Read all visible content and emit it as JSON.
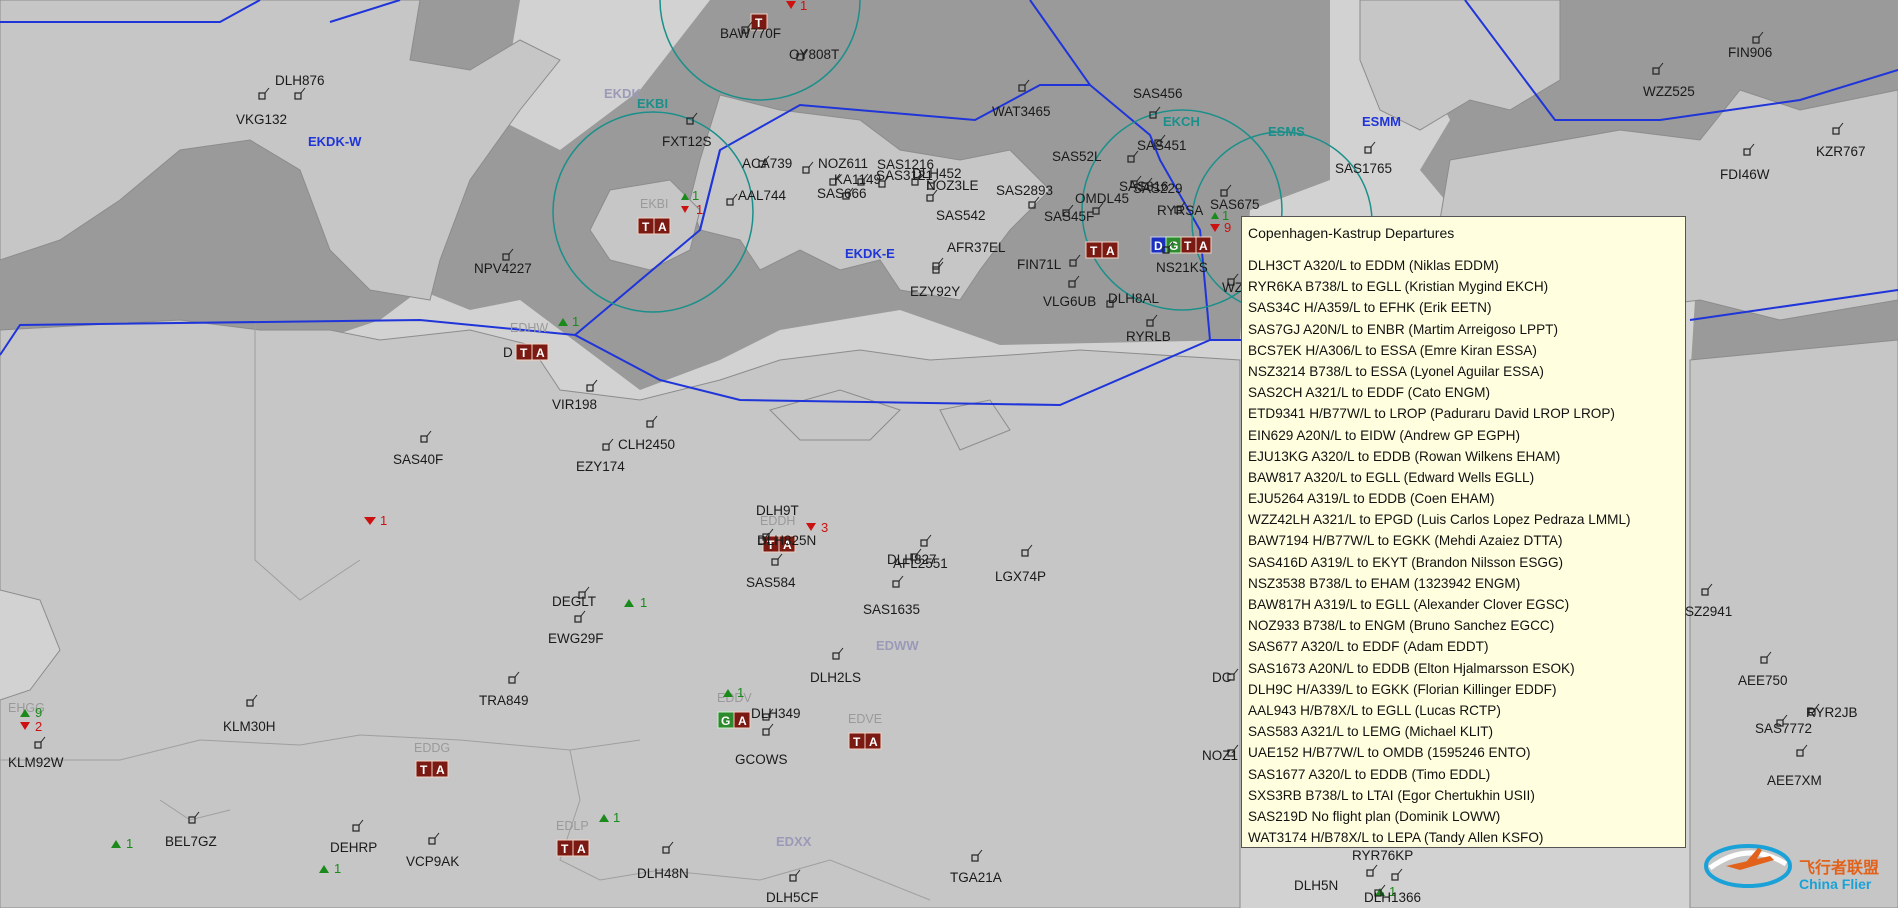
{
  "colors": {
    "background": "#d2d2d2",
    "land": "#c6c6c6",
    "water": "#9a9a9a",
    "fir_boundary": "#1f35d9",
    "ctr_ring": "#1b8f8a",
    "arrival_marker": "#1a8a1a",
    "departure_marker": "#cc1111",
    "atc_tower": "#7a1a12",
    "atc_delivery": "#1a2fbf",
    "atc_ground": "#2d8a2d",
    "panel_bg": "#fffedf"
  },
  "sectors": [
    {
      "id": "ekdk-w",
      "label": "EKDK-W"
    },
    {
      "id": "ekdk-e",
      "label": "EKDK-E"
    },
    {
      "id": "esmm",
      "label": "ESMM"
    },
    {
      "id": "edww",
      "label": "EDWW"
    },
    {
      "id": "edxx",
      "label": "EDXX"
    },
    {
      "id": "ekdk",
      "label": "EKDK"
    }
  ],
  "airports": [
    {
      "icao": "EKBI",
      "ring_label": "EKBI",
      "arrivals": "1",
      "departures": "1",
      "atc": [
        "T",
        "A"
      ]
    },
    {
      "icao": "EKCH",
      "ring_label": "EKCH",
      "arrivals": "1",
      "departures": "9",
      "atc": [
        "T",
        "A",
        "D",
        "G",
        "T",
        "A"
      ]
    },
    {
      "icao": "ESMS",
      "ring_label": "ESMS"
    },
    {
      "icao": "EKRN",
      "departures": "1",
      "atc": [
        "T"
      ]
    },
    {
      "icao": "EDHW",
      "label": "EDHW",
      "arrivals": "1",
      "atc": [
        "D",
        "T",
        "A"
      ]
    },
    {
      "icao": "EDDH",
      "label": "EDDH",
      "departures": "3",
      "atc": [
        "T",
        "A"
      ]
    },
    {
      "icao": "EDDV",
      "label": "EDDV",
      "arrivals": "1",
      "atc": [
        "G",
        "A"
      ]
    },
    {
      "icao": "EDVE",
      "label": "EDVE",
      "atc": [
        "T",
        "A"
      ]
    },
    {
      "icao": "EDDG",
      "label": "EDDG",
      "atc": [
        "T",
        "A"
      ]
    },
    {
      "icao": "EDLP",
      "label": "EDLP",
      "arrivals": "1",
      "atc": [
        "T",
        "A"
      ]
    },
    {
      "icao": "EHGG",
      "label": "EHGG",
      "arrivals": "9",
      "departures": "2"
    }
  ],
  "markers": {
    "degl_arrivals": "1",
    "west_departures": "1",
    "bel_arrivals": "1",
    "sw_arrivals": "1",
    "bottom_arrivals": "1"
  },
  "aircraft": [
    "BAW770F",
    "OY808T",
    "DLH876",
    "VKG132",
    "FXT12S",
    "ACA739",
    "NOZ611",
    "SAS1216",
    "KA1149",
    "SAS3121",
    "DLH452",
    "SAS666",
    "NOZ3LE",
    "AAL744",
    "SAS542",
    "AFR37EL",
    "EZY92Y",
    "NPV4227",
    "WAT3465",
    "SAS456",
    "SAS52L",
    "SAS451",
    "SAS816",
    "SAS229",
    "SAS2893",
    "SAS45F",
    "OMDL45",
    "FIN71L",
    "VLG6UB",
    "DLH8AL",
    "RYRLB",
    "NS21KS",
    "RYRSA",
    "SAS675",
    "SAS1765",
    "FIN906",
    "WZZ525",
    "FDI46W",
    "KZR767",
    "VIR198",
    "CLH2450",
    "SAS40F",
    "EZY174",
    "DLH9T",
    "DLH825N",
    "SAS584",
    "DLH827",
    "AFL2551",
    "LGX74P",
    "SAS1635",
    "DEGLT",
    "EWG29F",
    "TRA849",
    "DLH2LS",
    "DLH349",
    "GCOWS",
    "KLM30H",
    "KLM92W",
    "BEL7GZ",
    "DEHRP",
    "VCP9AK",
    "DLH48N",
    "DLH5CF",
    "TGA21A",
    "RYR76KP",
    "DLH5N",
    "DLH1366",
    "SZ2941",
    "AEE750",
    "RYR2JB",
    "SAS7772",
    "AEE7XM",
    "DC",
    "NOZ1",
    "WZ"
  ],
  "departures_panel": {
    "title": "Copenhagen-Kastrup Departures",
    "flights": [
      "DLH3CT A320/L to EDDM (Niklas EDDM)",
      "RYR6KA B738/L to EGLL (Kristian Mygind EKCH)",
      "SAS34C H/A359/L to EFHK (Erik EETN)",
      "SAS7GJ A20N/L to ENBR (Martim Arreigoso LPPT)",
      "BCS7EK H/A306/L to ESSA (Emre Kiran ESSA)",
      "NSZ3214 B738/L to ESSA (Lyonel Aguilar ESSA)",
      "SAS2CH A321/L to EDDF (Cato ENGM)",
      "ETD9341 H/B77W/L to LROP (Paduraru David LROP LROP)",
      "EIN629 A20N/L to EIDW (Andrew GP EGPH)",
      "EJU13KG A320/L to EDDB (Rowan Wilkens EHAM)",
      "BAW817 A320/L to EGLL (Edward Wells EGLL)",
      "EJU5264 A319/L to EDDB (Coen EHAM)",
      "WZZ42LH A321/L to EPGD (Luis Carlos Lopez Pedraza LMML)",
      "BAW7194 H/B77W/L to EGKK (Mehdi Azaiez DTTA)",
      "SAS416D A319/L to EKYT (Brandon Nilsson ESGG)",
      "NSZ3538 B738/L to EHAM (1323942 ENGM)",
      "BAW817H A319/L to EGLL (Alexander Clover EGSC)",
      "NOZ933 B738/L to ENGM (Bruno Sanchez EGCC)",
      "SAS677 A320/L to EDDF (Adam EDDT)",
      "SAS1673 A20N/L to EDDB (Elton Hjalmarsson ESOK)",
      "DLH9C H/A339/L to EGKK (Florian Killinger EDDF)",
      "AAL943 H/B78X/L to EGLL (Lucas RCTP)",
      "SAS583 A321/L to LEMG (Michael KLIT)",
      "UAE152 H/B77W/L to OMDB (1595246 ENTO)",
      "SAS1677 A320/L to EDDB (Timo EDDL)",
      "SXS3RB B738/L to LTAI (Egor Chertukhin USII)",
      "SAS219D No flight plan (Dominik LOWW)",
      "WAT3174 H/B78X/L to LEPA (Tandy Allen KSFO)"
    ]
  },
  "watermark": {
    "chinese": "飞行者联盟",
    "english": "China Flier"
  }
}
